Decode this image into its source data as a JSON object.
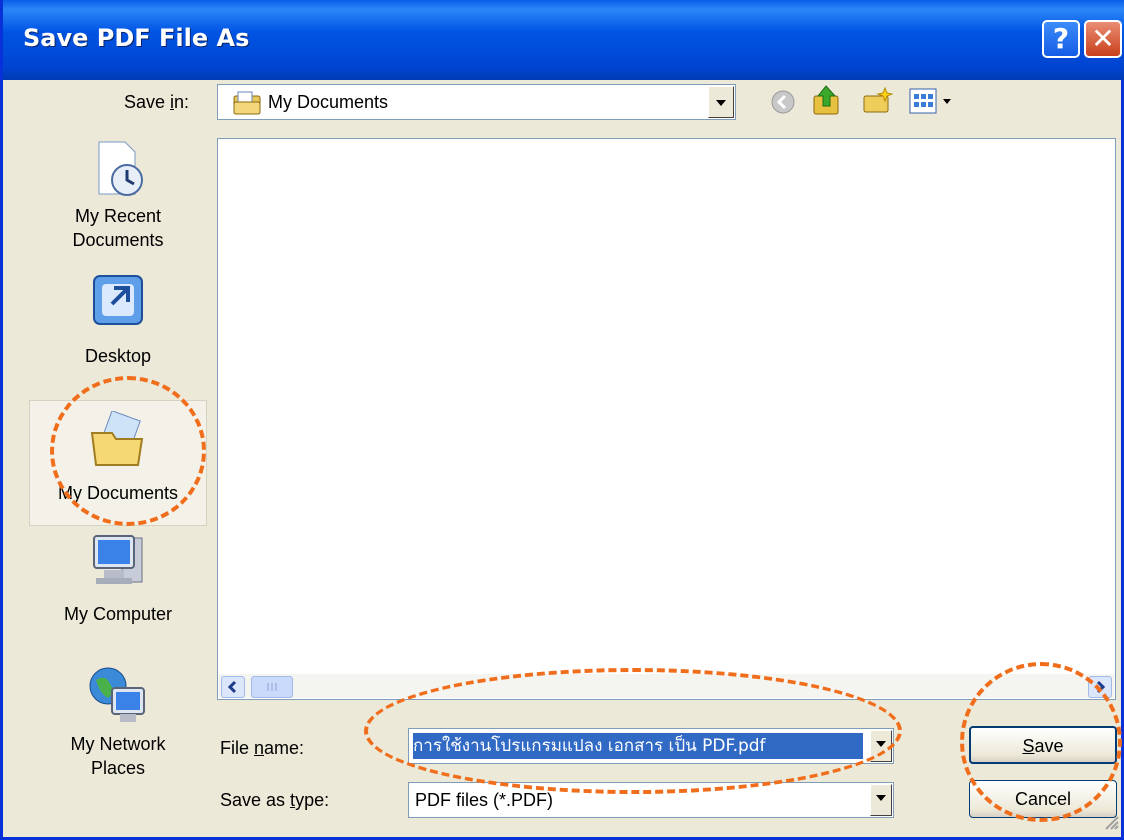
{
  "window": {
    "title": "Save PDF File As",
    "help_glyph": "?",
    "close_glyph": "✕"
  },
  "toolbar": {
    "save_in_pre": "Save ",
    "save_in_key": "i",
    "save_in_post": "n:",
    "location": "My Documents",
    "icons": [
      "back-icon",
      "up-folder-icon",
      "new-folder-icon",
      "views-menu-icon"
    ]
  },
  "places": [
    {
      "line1": "My Recent",
      "line2": "Documents",
      "icon": "recent-documents-icon"
    },
    {
      "line1": "Desktop",
      "line2": "",
      "icon": "desktop-icon"
    },
    {
      "line1": "My Documents",
      "line2": "",
      "icon": "my-documents-icon",
      "selected": true
    },
    {
      "line1": "My Computer",
      "line2": "",
      "icon": "my-computer-icon"
    },
    {
      "line1": "My Network",
      "line2": "Places",
      "icon": "network-places-icon"
    }
  ],
  "form": {
    "filename_pre": "File ",
    "filename_key": "n",
    "filename_post": "ame:",
    "filename_value": "การใช้งานโปรแกรมแปลง เอกสาร เป็น PDF.pdf",
    "type_pre": "Save as ",
    "type_key": "t",
    "type_post": "ype:",
    "type_value": "PDF files (*.PDF)"
  },
  "buttons": {
    "save_key": "S",
    "save_rest": "ave",
    "cancel": "Cancel"
  },
  "colors": {
    "title_bar": "#0054e3",
    "annotation": "#f06e1b",
    "selection": "#316ac5"
  }
}
